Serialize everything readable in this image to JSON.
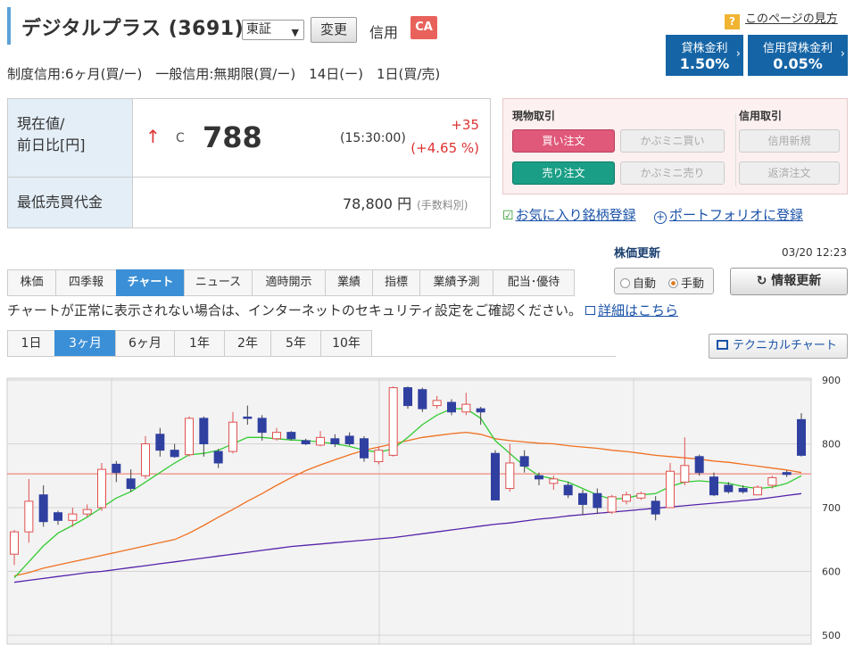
{
  "header": {
    "stock_name": "デジタルプラス (3691)",
    "exchange": "東証",
    "change_label": "変更",
    "credit_label": "信用",
    "ca_badge": "CA",
    "help_icon": "?",
    "help_link": "このページの見方"
  },
  "rates": [
    {
      "label": "貸株金利",
      "value": "1.50%"
    },
    {
      "label": "信用貸株金利",
      "value": "0.05%"
    }
  ],
  "credit_info": "制度信用:6ヶ月(買/ー)　一般信用:無期限(買/ー)　14日(ー)　1日(買/売)",
  "quote": {
    "price_label_1": "現在値/",
    "price_label_2": "前日比[円]",
    "arrow": "↑",
    "mark": "C",
    "price": "788",
    "time": "(15:30:00)",
    "change_abs": "+35",
    "change_pct": "(+4.65 %)",
    "min_label": "最低売買代金",
    "min_value": "78,800 円",
    "fee_note": "(手数料別)"
  },
  "trade": {
    "spot_header": "現物取引",
    "credit_header": "信用取引",
    "buy": "買い注文",
    "sell": "売り注文",
    "kabumini_buy": "かぶミニ買い",
    "kabumini_sell": "かぶミニ売り",
    "credit_new": "信用新規",
    "credit_close": "返済注文"
  },
  "links": {
    "favorite": "お気に入り銘柄登録",
    "portfolio": "ポートフォリオに登録"
  },
  "update": {
    "title": "株価更新",
    "time": "03/20 12:23",
    "auto": "自動",
    "manual": "手動",
    "refresh": "情報更新"
  },
  "tabs": [
    "株価",
    "四季報",
    "チャート",
    "ニュース",
    "適時開示",
    "業績",
    "指標",
    "業績予測",
    "配当･優待"
  ],
  "notice": {
    "text": "チャートが正常に表示されない場合は、インターネットのセキュリティ設定をご確認ください。",
    "link": "詳細はこちら"
  },
  "ranges": [
    "1日",
    "3ヶ月",
    "6ヶ月",
    "1年",
    "2年",
    "5年",
    "10年"
  ],
  "tech_chart": "テクニカルチャート",
  "colors": {
    "up_candle": "#e05050",
    "down_candle": "#3040a0",
    "ma_short": "#33cc33",
    "ma_mid": "#f07020",
    "ma_long": "#5522aa",
    "ref_line": "#f07060"
  },
  "chart_data": {
    "type": "candlestick",
    "y_ticks": [
      900,
      800,
      700,
      600,
      500
    ],
    "ylim": [
      500,
      900
    ],
    "reference_price": 753,
    "candles": [
      [
        627,
        662,
        665,
        610
      ],
      [
        662,
        710,
        745,
        645
      ],
      [
        720,
        678,
        735,
        670
      ],
      [
        692,
        680,
        695,
        673
      ],
      [
        680,
        690,
        700,
        670
      ],
      [
        690,
        697,
        705,
        685
      ],
      [
        700,
        760,
        770,
        695
      ],
      [
        768,
        755,
        773,
        740
      ],
      [
        745,
        730,
        760,
        725
      ],
      [
        750,
        800,
        812,
        745
      ],
      [
        815,
        790,
        825,
        780
      ],
      [
        790,
        780,
        800,
        778
      ],
      [
        783,
        840,
        843,
        780
      ],
      [
        840,
        800,
        843,
        780
      ],
      [
        788,
        770,
        792,
        762
      ],
      [
        788,
        834,
        850,
        785
      ],
      [
        842,
        840,
        860,
        830
      ],
      [
        840,
        818,
        845,
        805
      ],
      [
        808,
        818,
        825,
        805
      ],
      [
        818,
        808,
        820,
        805
      ],
      [
        805,
        800,
        808,
        798
      ],
      [
        798,
        810,
        820,
        796
      ],
      [
        808,
        800,
        815,
        795
      ],
      [
        812,
        800,
        818,
        797
      ],
      [
        808,
        778,
        812,
        772
      ],
      [
        772,
        790,
        795,
        768
      ],
      [
        782,
        888,
        890,
        780
      ],
      [
        888,
        860,
        890,
        855
      ],
      [
        885,
        855,
        888,
        850
      ],
      [
        860,
        868,
        875,
        855
      ],
      [
        865,
        850,
        870,
        845
      ],
      [
        850,
        862,
        880,
        845
      ],
      [
        855,
        850,
        858,
        830
      ],
      [
        785,
        712,
        790,
        712
      ],
      [
        730,
        770,
        800,
        725
      ],
      [
        780,
        765,
        790,
        755
      ],
      [
        750,
        745,
        755,
        735
      ],
      [
        738,
        745,
        750,
        728
      ],
      [
        735,
        720,
        740,
        715
      ],
      [
        722,
        705,
        728,
        688
      ],
      [
        722,
        700,
        730,
        690
      ],
      [
        693,
        717,
        720,
        690
      ],
      [
        710,
        720,
        725,
        705
      ],
      [
        715,
        722,
        725,
        712
      ],
      [
        710,
        690,
        718,
        680
      ],
      [
        700,
        757,
        770,
        700
      ],
      [
        740,
        766,
        810,
        735
      ],
      [
        780,
        755,
        783,
        750
      ],
      [
        748,
        720,
        755,
        718
      ],
      [
        735,
        725,
        740,
        722
      ],
      [
        730,
        725,
        735,
        722
      ],
      [
        720,
        732,
        735,
        720
      ],
      [
        735,
        747,
        750,
        730
      ],
      [
        755,
        752,
        758,
        748
      ],
      [
        838,
        782,
        848,
        780
      ]
    ],
    "ma_short": [
      590,
      615,
      640,
      660,
      672,
      685,
      700,
      715,
      725,
      740,
      755,
      770,
      783,
      785,
      790,
      800,
      810,
      810,
      808,
      806,
      805,
      803,
      800,
      796,
      790,
      787,
      792,
      810,
      830,
      845,
      855,
      855,
      840,
      805,
      785,
      765,
      750,
      745,
      740,
      730,
      720,
      713,
      715,
      720,
      722,
      733,
      740,
      742,
      740,
      738,
      733,
      730,
      732,
      738,
      750
    ],
    "ma_mid": [
      593,
      598,
      605,
      610,
      615,
      620,
      625,
      630,
      635,
      640,
      645,
      650,
      660,
      672,
      685,
      697,
      710,
      722,
      735,
      747,
      758,
      767,
      775,
      783,
      790,
      795,
      800,
      805,
      810,
      813,
      816,
      818,
      815,
      808,
      805,
      803,
      801,
      800,
      797,
      795,
      793,
      790,
      788,
      785,
      782,
      780,
      778,
      776,
      773,
      771,
      768,
      765,
      762,
      759,
      755
    ],
    "ma_long": [
      583,
      586,
      589,
      592,
      595,
      598,
      600,
      603,
      606,
      609,
      612,
      615,
      618,
      621,
      624,
      627,
      630,
      633,
      636,
      639,
      641,
      643,
      645,
      647,
      649,
      651,
      653,
      656,
      659,
      662,
      665,
      668,
      671,
      674,
      676,
      679,
      682,
      684,
      687,
      689,
      691,
      693,
      695,
      697,
      699,
      701,
      703,
      705,
      707,
      709,
      711,
      713,
      716,
      719,
      722
    ]
  }
}
